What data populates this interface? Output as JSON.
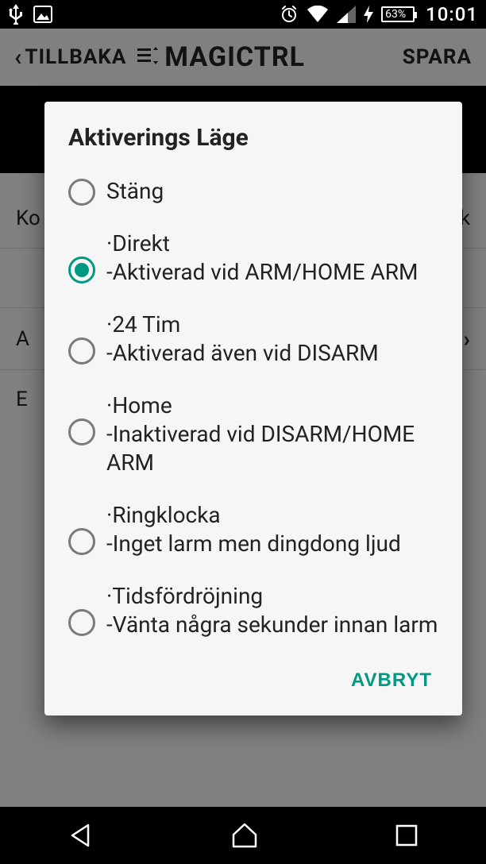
{
  "status": {
    "battery_text": "63%",
    "clock": "10:01"
  },
  "header": {
    "back_label": "TILLBAKA",
    "title": "MAGICTRL",
    "save_label": "SPARA"
  },
  "background": {
    "row0": "Ko",
    "row0_right": "uk",
    "row1": "A",
    "row2": "E"
  },
  "dialog": {
    "title": "Aktiverings Läge",
    "cancel_label": "AVBRYT",
    "selected_index": 1,
    "options": [
      {
        "line1": "Stäng"
      },
      {
        "line1": "·Direkt",
        "line2": "-Aktiverad vid ARM/HOME ARM"
      },
      {
        "line1": "·24 Tim",
        "line2": "-Aktiverad även vid DISARM"
      },
      {
        "line1": "·Home",
        "line2": "-Inaktiverad vid DISARM/HOME ARM"
      },
      {
        "line1": "·Ringklocka",
        "line2": "-Inget larm men dingdong ljud"
      },
      {
        "line1": "·Tidsfördröjning",
        "line2": "-Vänta några sekunder innan larm"
      }
    ]
  }
}
